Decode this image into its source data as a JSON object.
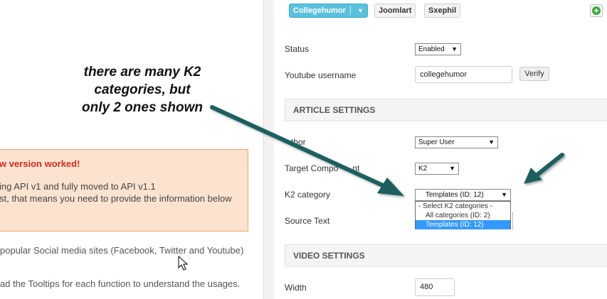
{
  "annotation": {
    "lines": [
      "there are many K2",
      "categories, but",
      "only 2 ones shown"
    ]
  },
  "left_panel": {
    "alert": {
      "title": "w version worked!",
      "lines": [
        "ing API v1 and fully moved to API v1.1",
        "st, that means you need to provide the information below"
      ]
    },
    "texts": [
      "popular Social media sites (Facebook, Twitter and Youtube)",
      "ad the Tooltips for each function to understand the usages."
    ]
  },
  "toolbar": {
    "primary_button": "Collegehumor",
    "buttons": [
      "Joomlart",
      "Sxephil"
    ],
    "add_icon": "plus-circle-icon"
  },
  "form": {
    "status": {
      "label": "Status",
      "value": "Enabled"
    },
    "youtube_username": {
      "label": "Youtube username",
      "value": "collegehumor",
      "verify_label": "Verify"
    },
    "article_section": "ARTICLE SETTINGS",
    "author": {
      "label": "Author",
      "visible_label": "thor",
      "value": "Super User"
    },
    "target_component": {
      "label": "Target Component",
      "visible_label": "Target Compo",
      "visible_suffix": "nt",
      "value": "K2"
    },
    "k2_category": {
      "label": "K2 category",
      "value": "Templates (ID: 12)",
      "options": [
        "- Select K2 categories -",
        "All categories (ID: 2)",
        "Templates (ID: 12)"
      ],
      "selected_index": 2
    },
    "source_text": {
      "label": "Source Text"
    },
    "video_section": "VIDEO SETTINGS",
    "width": {
      "label": "Width",
      "value": "480"
    }
  },
  "colors": {
    "arrow": "#1f5f5f",
    "primary_button": "#5bc0de",
    "alert_bg": "#fbe3d0",
    "alert_title": "#d62a1e",
    "selected_option": "#3399ff"
  }
}
